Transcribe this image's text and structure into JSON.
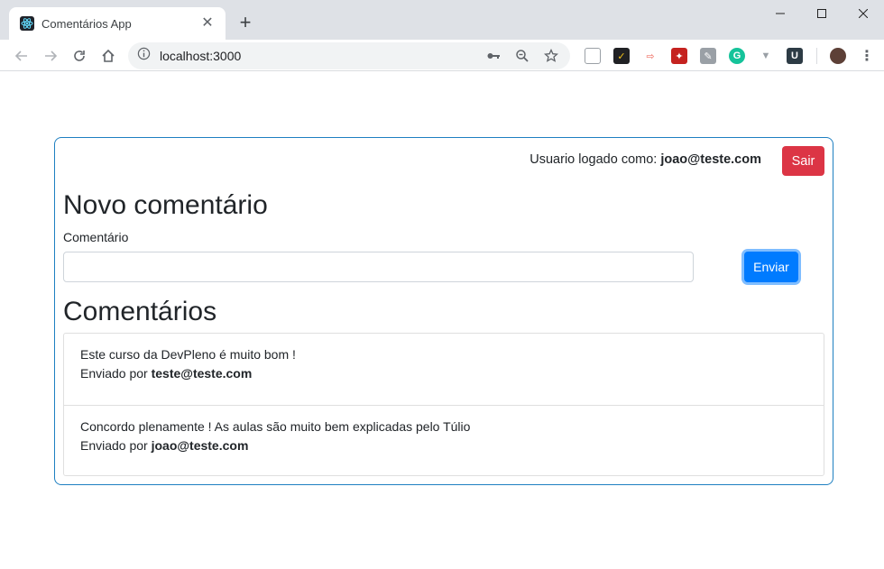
{
  "browser": {
    "tab_title": "Comentários App",
    "url": "localhost:3000"
  },
  "header": {
    "user_prefix": "Usuario logado como:",
    "user_email": "joao@teste.com",
    "logout_label": "Sair"
  },
  "form": {
    "title": "Novo comentário",
    "label": "Comentário",
    "value": "",
    "submit_label": "Enviar"
  },
  "comments": {
    "title": "Comentários",
    "sent_by_prefix": "Enviado por",
    "items": [
      {
        "text": "Este curso da DevPleno é muito bom !",
        "author": "teste@teste.com"
      },
      {
        "text": "Concordo plenamente ! As aulas são muito bem explicadas pelo Túlio",
        "author": "joao@teste.com"
      }
    ]
  },
  "colors": {
    "danger": "#dc3545",
    "primary": "#007bff",
    "card_border": "#1e7fc1"
  }
}
